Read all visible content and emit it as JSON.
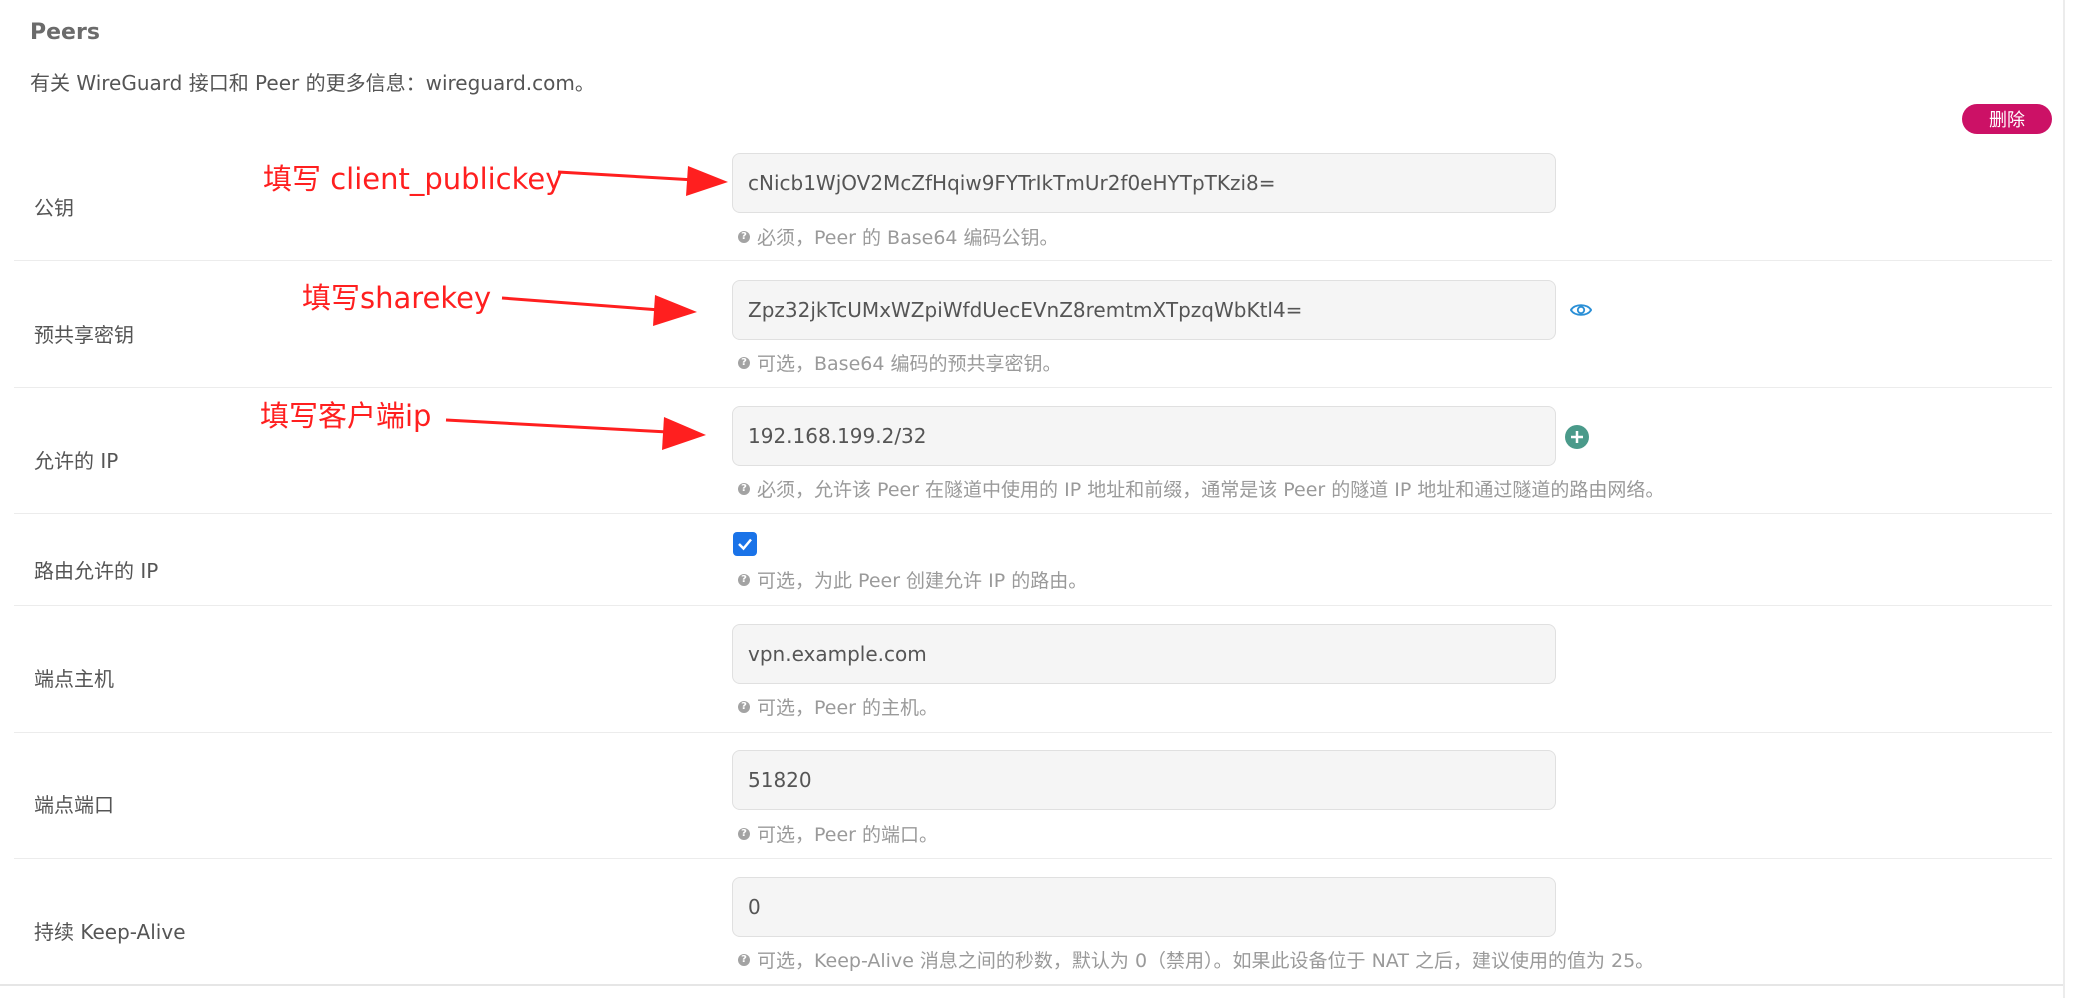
{
  "section": {
    "title": "Peers",
    "description": "有关 WireGuard 接口和 Peer 的更多信息：wireguard.com。",
    "delete_label": "删除"
  },
  "fields": {
    "public_key": {
      "label": "公钥",
      "value": "cNicb1WjOV2McZfHqiw9FYTrIkTmUr2f0eHYTpTKzi8=",
      "help": "必须，Peer 的 Base64 编码公钥。"
    },
    "preshared_key": {
      "label": "预共享密钥",
      "value": "Zpz32jkTcUMxWZpiWfdUecEVnZ8remtmXTpzqWbKtl4=",
      "help": "可选，Base64 编码的预共享密钥。"
    },
    "allowed_ips": {
      "label": "允许的 IP",
      "value": "192.168.199.2/32",
      "help": "必须，允许该 Peer 在隧道中使用的 IP 地址和前缀，通常是该 Peer 的隧道 IP 地址和通过隧道的路由网络。"
    },
    "route_allowed_ips": {
      "label": "路由允许的 IP",
      "checked": true,
      "help": "可选，为此 Peer 创建允许 IP 的路由。"
    },
    "endpoint_host": {
      "label": "端点主机",
      "placeholder": "vpn.example.com",
      "help": "可选，Peer 的主机。"
    },
    "endpoint_port": {
      "label": "端点端口",
      "placeholder": "51820",
      "help": "可选，Peer 的端口。"
    },
    "keepalive": {
      "label": "持续 Keep-Alive",
      "placeholder": "0",
      "help": "可选，Keep-Alive 消息之间的秒数，默认为 0（禁用）。如果此设备位于 NAT 之后，建议使用的值为 25。"
    }
  },
  "annotations": {
    "public_key": "填写 client_publickey",
    "preshared_key": "填写sharekey",
    "allowed_ips": "填写客户端ip"
  },
  "icons": {
    "help": "question-circle-icon",
    "reveal": "eye-icon",
    "add": "plus-circle-icon",
    "check": "checkmark-icon"
  },
  "colors": {
    "delete_button": "#cc1166",
    "annotation": "#ff1f1f",
    "checkbox": "#1a73e8",
    "plus_icon": "#4a9a8a",
    "eye_icon": "#2a8fd6"
  }
}
